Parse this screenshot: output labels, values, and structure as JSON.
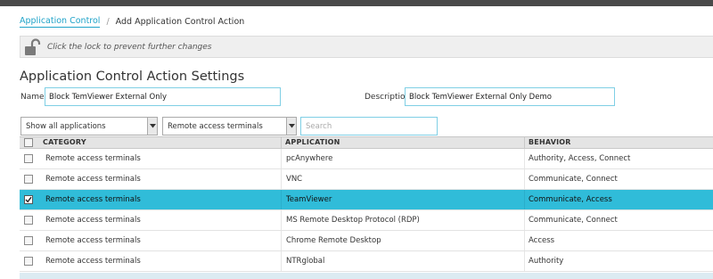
{
  "breadcrumb": {
    "parent": "Application Control",
    "separator": "/",
    "current": "Add Application Control Action"
  },
  "lockbar": {
    "text": "Click the lock to prevent further changes",
    "icon": "unlocked-padlock-icon"
  },
  "settings": {
    "title": "Application Control Action Settings",
    "name_label": "Name",
    "name_value": "Block TemViewer External Only",
    "description_label": "Description",
    "description_value": "Block TemViewer External Only Demo"
  },
  "filters": {
    "show_select": "Show all applications",
    "category_select": "Remote access terminals",
    "search_placeholder": "Search"
  },
  "grid": {
    "columns": [
      "CATEGORY",
      "APPLICATION",
      "BEHAVIOR"
    ],
    "rows": [
      {
        "category": "Remote access terminals",
        "application": "pcAnywhere",
        "behavior": "Authority, Access, Connect",
        "checked": false
      },
      {
        "category": "Remote access terminals",
        "application": "VNC",
        "behavior": "Communicate, Connect",
        "checked": false
      },
      {
        "category": "Remote access terminals",
        "application": "TeamViewer",
        "behavior": "Communicate, Access",
        "checked": true
      },
      {
        "category": "Remote access terminals",
        "application": "MS Remote Desktop Protocol (RDP)",
        "behavior": "Communicate, Connect",
        "checked": false
      },
      {
        "category": "Remote access terminals",
        "application": "Chrome Remote Desktop",
        "behavior": "Access",
        "checked": false
      },
      {
        "category": "Remote access terminals",
        "application": "NTRglobal",
        "behavior": "Authority",
        "checked": false
      }
    ],
    "selected_row_color": "#30bcd9"
  },
  "colors": {
    "accent": "#1fa3c9",
    "input_border": "#7fcfe5",
    "topbar": "#4a4a4a"
  }
}
